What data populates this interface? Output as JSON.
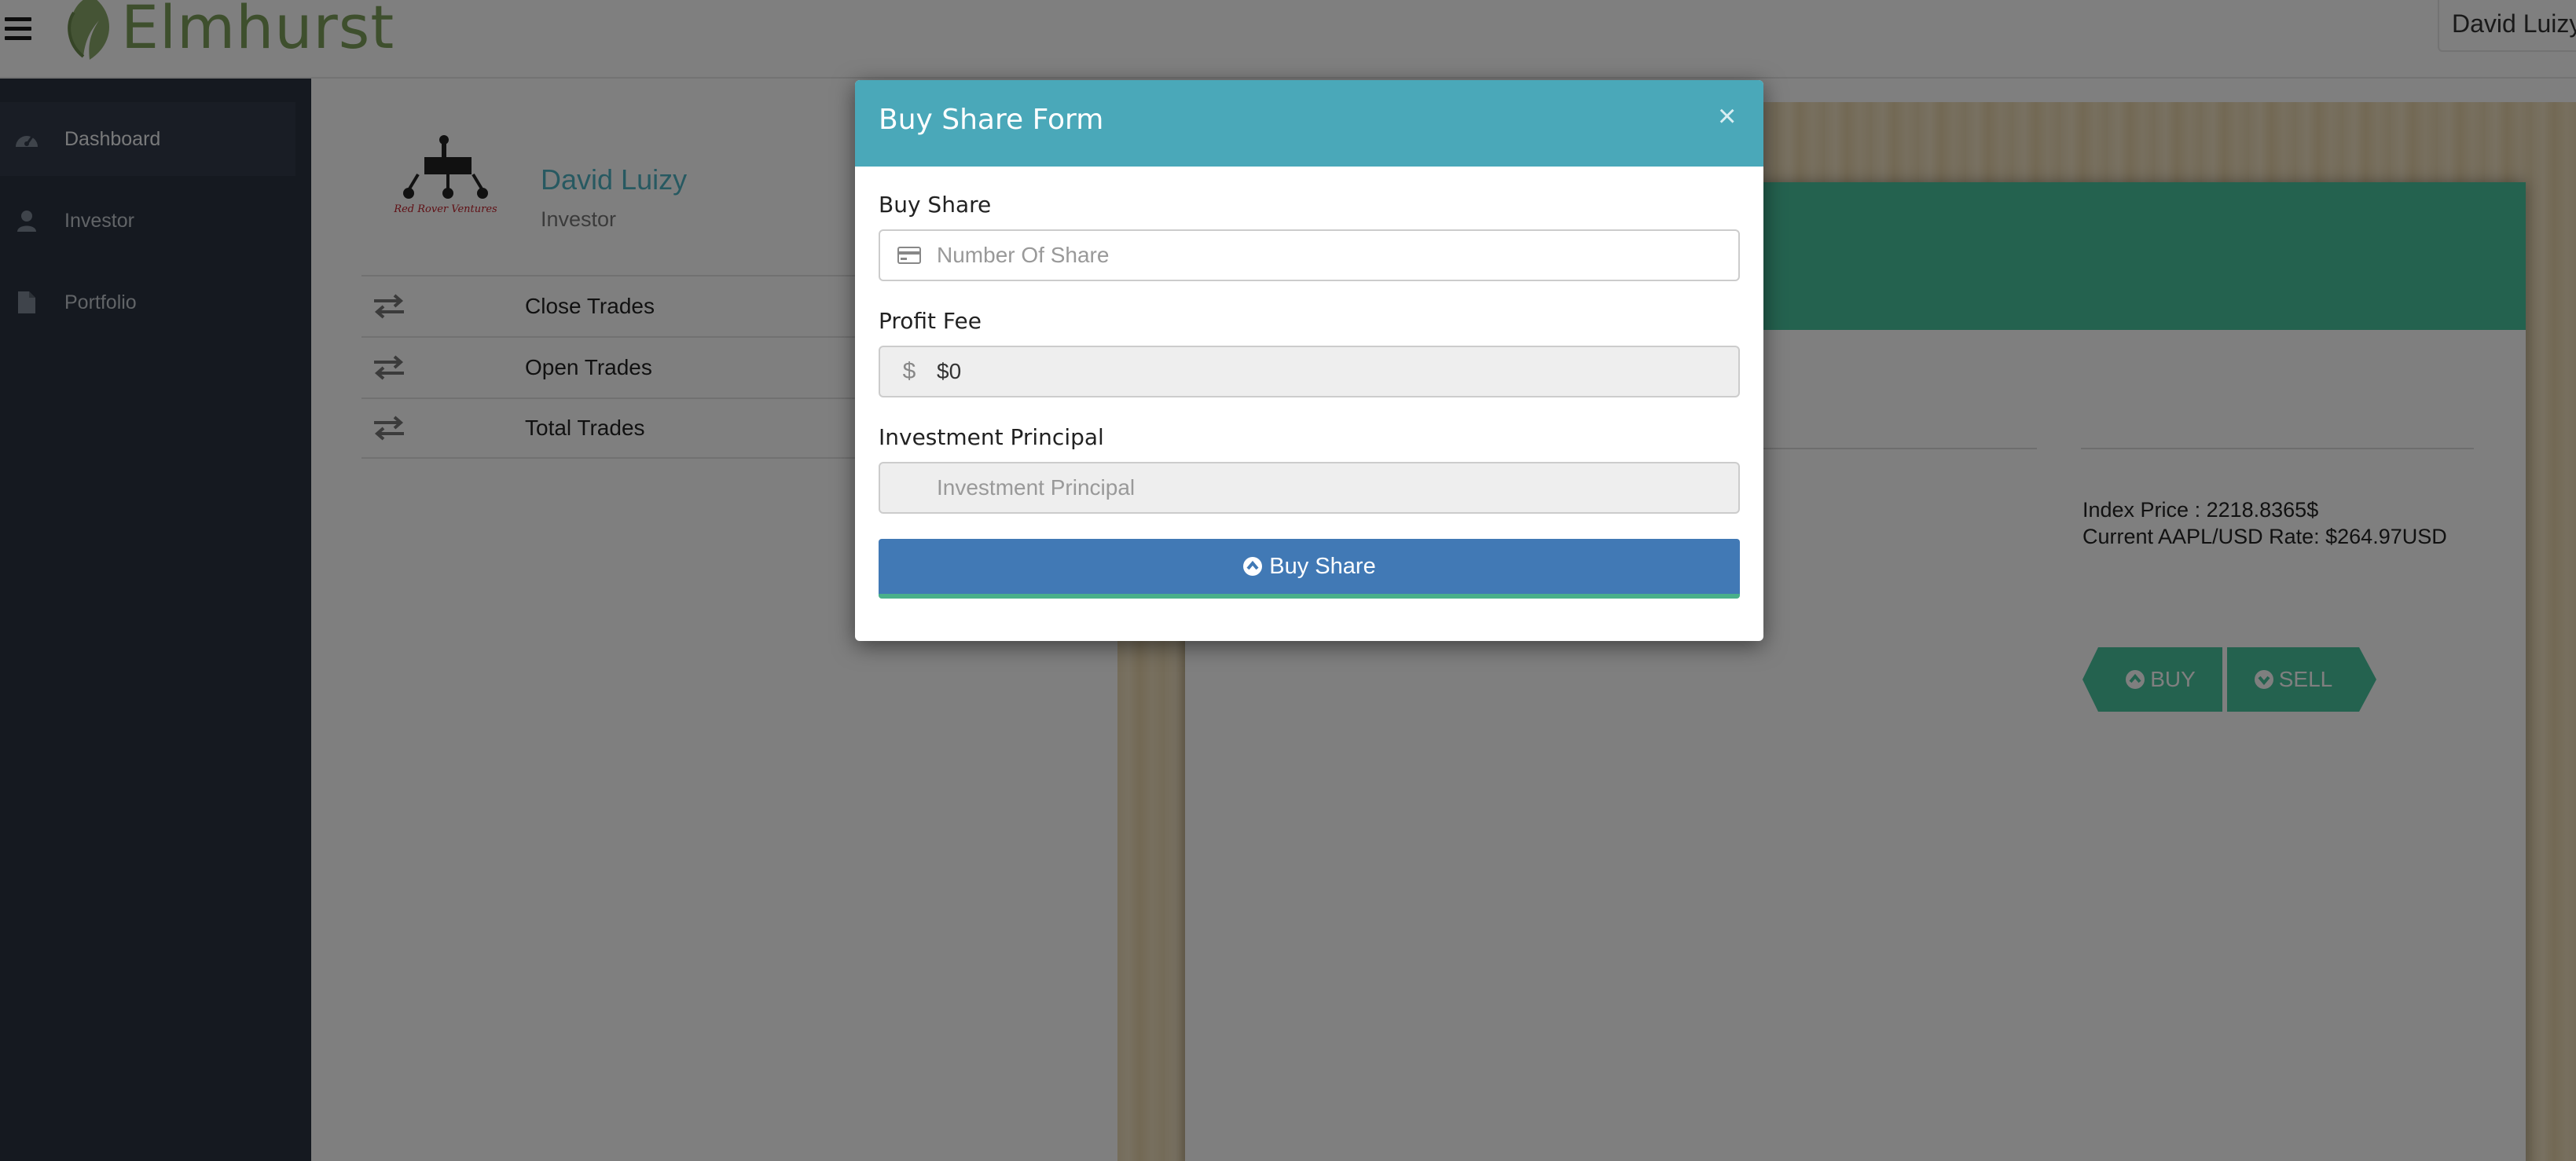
{
  "header": {
    "brand": "Elmhurst",
    "user_name": "David Luizy"
  },
  "sidebar": {
    "items": [
      {
        "label": "Dashboard",
        "icon": "dashboard-icon",
        "active": true
      },
      {
        "label": "Investor",
        "icon": "user-icon",
        "active": false
      },
      {
        "label": "Portfolio",
        "icon": "file-icon",
        "active": false
      }
    ]
  },
  "profile": {
    "name": "David Luizy",
    "role": "Investor",
    "logo_text": "Red Rover Ventures"
  },
  "trades": [
    {
      "label": "Close Trades",
      "icon": "exchange-icon"
    },
    {
      "label": "Open Trades",
      "icon": "exchange-icon"
    },
    {
      "label": "Total Trades",
      "icon": "exchange-icon"
    }
  ],
  "market": {
    "index_price": "Index Price : 2218.8365$",
    "rate": "Current AAPL/USD Rate: $264.97USD",
    "buy_label": "BUY",
    "sell_label": "SELL"
  },
  "modal": {
    "title": "Buy Share Form",
    "close_symbol": "×",
    "buy_share_label": "Buy Share",
    "buy_share_placeholder": "Number Of Share",
    "profit_fee_label": "Profit Fee",
    "profit_fee_value": "$0",
    "profit_fee_icon": "$",
    "principal_label": "Investment Principal",
    "principal_placeholder": "Investment Principal",
    "submit_label": "Buy Share"
  },
  "colors": {
    "sidebar_bg": "#2a3241",
    "modal_header": "#4aa8b9",
    "submit_button": "#4179b5",
    "accent_green": "#48c49f",
    "brand_green": "#7d9e5a"
  }
}
